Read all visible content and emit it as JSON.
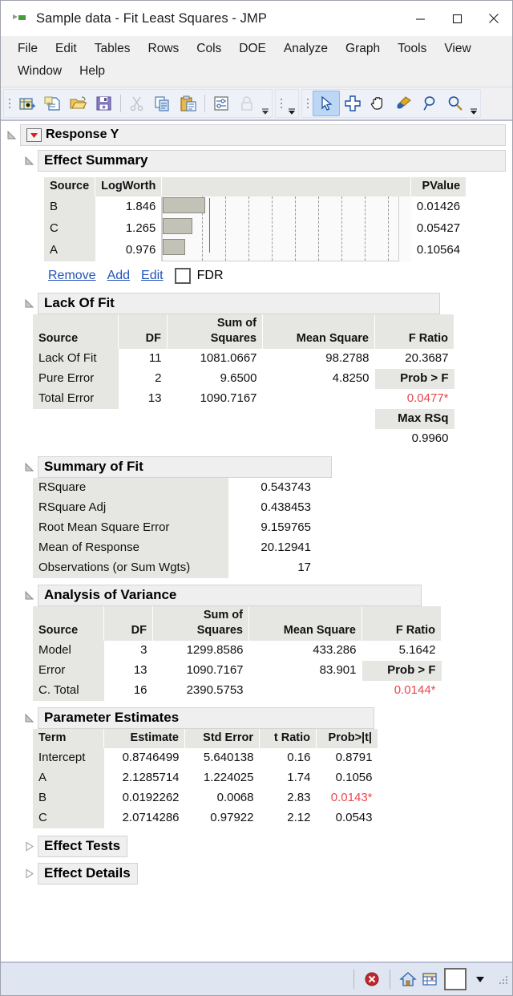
{
  "window": {
    "title": "Sample data - Fit Least Squares - JMP",
    "app_icon": "jmp-icon",
    "controls": [
      {
        "name": "minimize-button",
        "glyph": "—"
      },
      {
        "name": "maximize-button",
        "glyph": "□"
      },
      {
        "name": "close-button",
        "glyph": "✕"
      }
    ]
  },
  "menubar": {
    "items": [
      {
        "label": "File"
      },
      {
        "label": "Edit"
      },
      {
        "label": "Tables"
      },
      {
        "label": "Rows"
      },
      {
        "label": "Cols"
      },
      {
        "label": "DOE"
      },
      {
        "label": "Analyze"
      },
      {
        "label": "Graph"
      },
      {
        "label": "Tools"
      },
      {
        "label": "View"
      },
      {
        "label": "Window"
      },
      {
        "label": "Help"
      }
    ]
  },
  "toolbar": {
    "groups": [
      {
        "name": "file-group",
        "buttons": [
          {
            "name": "new-data-table-icon",
            "title": "New Data Table"
          },
          {
            "name": "new-script-icon",
            "title": "New Script"
          },
          {
            "name": "open-icon",
            "title": "Open"
          },
          {
            "name": "save-icon",
            "title": "Save"
          },
          {
            "name": "cut-icon",
            "title": "Cut",
            "disabled": true
          },
          {
            "name": "copy-icon",
            "title": "Copy"
          },
          {
            "name": "paste-icon",
            "title": "Paste"
          },
          {
            "name": "data-filter-icon",
            "title": "Data Filter"
          },
          {
            "name": "lock-icon",
            "title": "Lock",
            "disabled": true
          }
        ]
      },
      {
        "name": "empty-group",
        "buttons": []
      },
      {
        "name": "tools-group",
        "buttons": [
          {
            "name": "arrow-tool-icon",
            "title": "Arrow",
            "selected": true
          },
          {
            "name": "crosshair-tool-icon",
            "title": "Crosshairs"
          },
          {
            "name": "hand-tool-icon",
            "title": "Grabber"
          },
          {
            "name": "brush-tool-icon",
            "title": "Brush"
          },
          {
            "name": "lasso-tool-icon",
            "title": "Lasso"
          },
          {
            "name": "magnifier-tool-icon",
            "title": "Magnifier"
          }
        ]
      }
    ]
  },
  "report": {
    "response": {
      "title": "Response Y"
    },
    "effect_summary": {
      "title": "Effect Summary",
      "columns": [
        "Source",
        "LogWorth",
        "",
        "PValue"
      ],
      "rows": [
        {
          "source": "B",
          "logworth": "1.846",
          "pvalue": "0.01426"
        },
        {
          "source": "C",
          "logworth": "1.265",
          "pvalue": "0.05427"
        },
        {
          "source": "A",
          "logworth": "0.976",
          "pvalue": "0.10564"
        }
      ],
      "actions": [
        {
          "label": "Remove",
          "name": "remove-link"
        },
        {
          "label": "Add",
          "name": "add-link"
        },
        {
          "label": "Edit",
          "name": "edit-link"
        }
      ],
      "fdr_label": "FDR",
      "fdr_checked": false
    },
    "lack_of_fit": {
      "title": "Lack Of Fit",
      "columns": [
        "Source",
        "DF",
        "Sum of\nSquares",
        "Mean Square",
        "F Ratio"
      ],
      "rows": [
        {
          "source": "Lack Of Fit",
          "df": "11",
          "ss": "1081.0667",
          "ms": "98.2788",
          "f": "20.3687"
        },
        {
          "source": "Pure Error",
          "df": "2",
          "ss": "9.6500",
          "ms": "4.8250",
          "f": "Prob > F"
        },
        {
          "source": "Total Error",
          "df": "13",
          "ss": "1090.7167",
          "ms": "",
          "f": "0.0477*"
        }
      ],
      "max_rsq_label": "Max RSq",
      "max_rsq_value": "0.9960"
    },
    "summary_of_fit": {
      "title": "Summary of Fit",
      "rows": [
        {
          "label": "RSquare",
          "value": "0.543743"
        },
        {
          "label": "RSquare Adj",
          "value": "0.438453"
        },
        {
          "label": "Root Mean Square Error",
          "value": "9.159765"
        },
        {
          "label": "Mean of Response",
          "value": "20.12941"
        },
        {
          "label": "Observations (or Sum Wgts)",
          "value": "17"
        }
      ]
    },
    "analysis_of_variance": {
      "title": "Analysis of Variance",
      "columns": [
        "Source",
        "DF",
        "Sum of\nSquares",
        "Mean Square",
        "F Ratio"
      ],
      "rows": [
        {
          "source": "Model",
          "df": "3",
          "ss": "1299.8586",
          "ms": "433.286",
          "f": "5.1642"
        },
        {
          "source": "Error",
          "df": "13",
          "ss": "1090.7167",
          "ms": "83.901",
          "f": "Prob > F"
        },
        {
          "source": "C. Total",
          "df": "16",
          "ss": "2390.5753",
          "ms": "",
          "f": "0.0144*"
        }
      ]
    },
    "parameter_estimates": {
      "title": "Parameter Estimates",
      "columns": [
        "Term",
        "Estimate",
        "Std Error",
        "t Ratio",
        "Prob>|t|"
      ],
      "rows": [
        {
          "term": "Intercept",
          "estimate": "0.8746499",
          "stderr": "5.640138",
          "t": "0.16",
          "p": "0.8791",
          "sig": false
        },
        {
          "term": "A",
          "estimate": "2.1285714",
          "stderr": "1.224025",
          "t": "1.74",
          "p": "0.1056",
          "sig": false
        },
        {
          "term": "B",
          "estimate": "0.0192262",
          "stderr": "0.0068",
          "t": "2.83",
          "p": "0.0143*",
          "sig": true
        },
        {
          "term": "C",
          "estimate": "2.0714286",
          "stderr": "0.97922",
          "t": "2.12",
          "p": "0.0543",
          "sig": false
        }
      ]
    },
    "effect_tests": {
      "title": "Effect Tests",
      "collapsed": true
    },
    "effect_details": {
      "title": "Effect Details",
      "collapsed": true
    }
  },
  "statusbar": {
    "buttons": [
      {
        "name": "stop-icon",
        "title": "Stop"
      },
      {
        "name": "home-icon",
        "title": "Home Window"
      },
      {
        "name": "data-table-icon",
        "title": "Data Table"
      },
      {
        "name": "color-swatch-icon",
        "title": "Color"
      },
      {
        "name": "dropdown-arrow-icon",
        "title": "More"
      }
    ]
  },
  "chart_data": {
    "type": "bar",
    "title": "Effect Summary LogWorth",
    "categories": [
      "B",
      "C",
      "A"
    ],
    "values": [
      1.846,
      1.265,
      0.976
    ],
    "pvalues": [
      0.01426,
      0.05427,
      0.10564
    ],
    "xlabel": "LogWorth",
    "ylabel": "",
    "xlim": [
      0,
      10
    ],
    "reference_line": 2.0,
    "gridlines": [
      1,
      2,
      3,
      4,
      5,
      6,
      7,
      8,
      9
    ],
    "grid": true,
    "legend": "none",
    "orientation": "horizontal",
    "bar_color": "#c3c2b6",
    "reference_color": "#3a6fd8"
  },
  "colors": {
    "significance_red": "#e8484f",
    "link_blue": "#2253b8",
    "header_gray": "#e6e6e3",
    "section_gray": "#efefef",
    "toolbar_selection": "#bcd6f5",
    "statusbar": "#dfe6f2"
  }
}
